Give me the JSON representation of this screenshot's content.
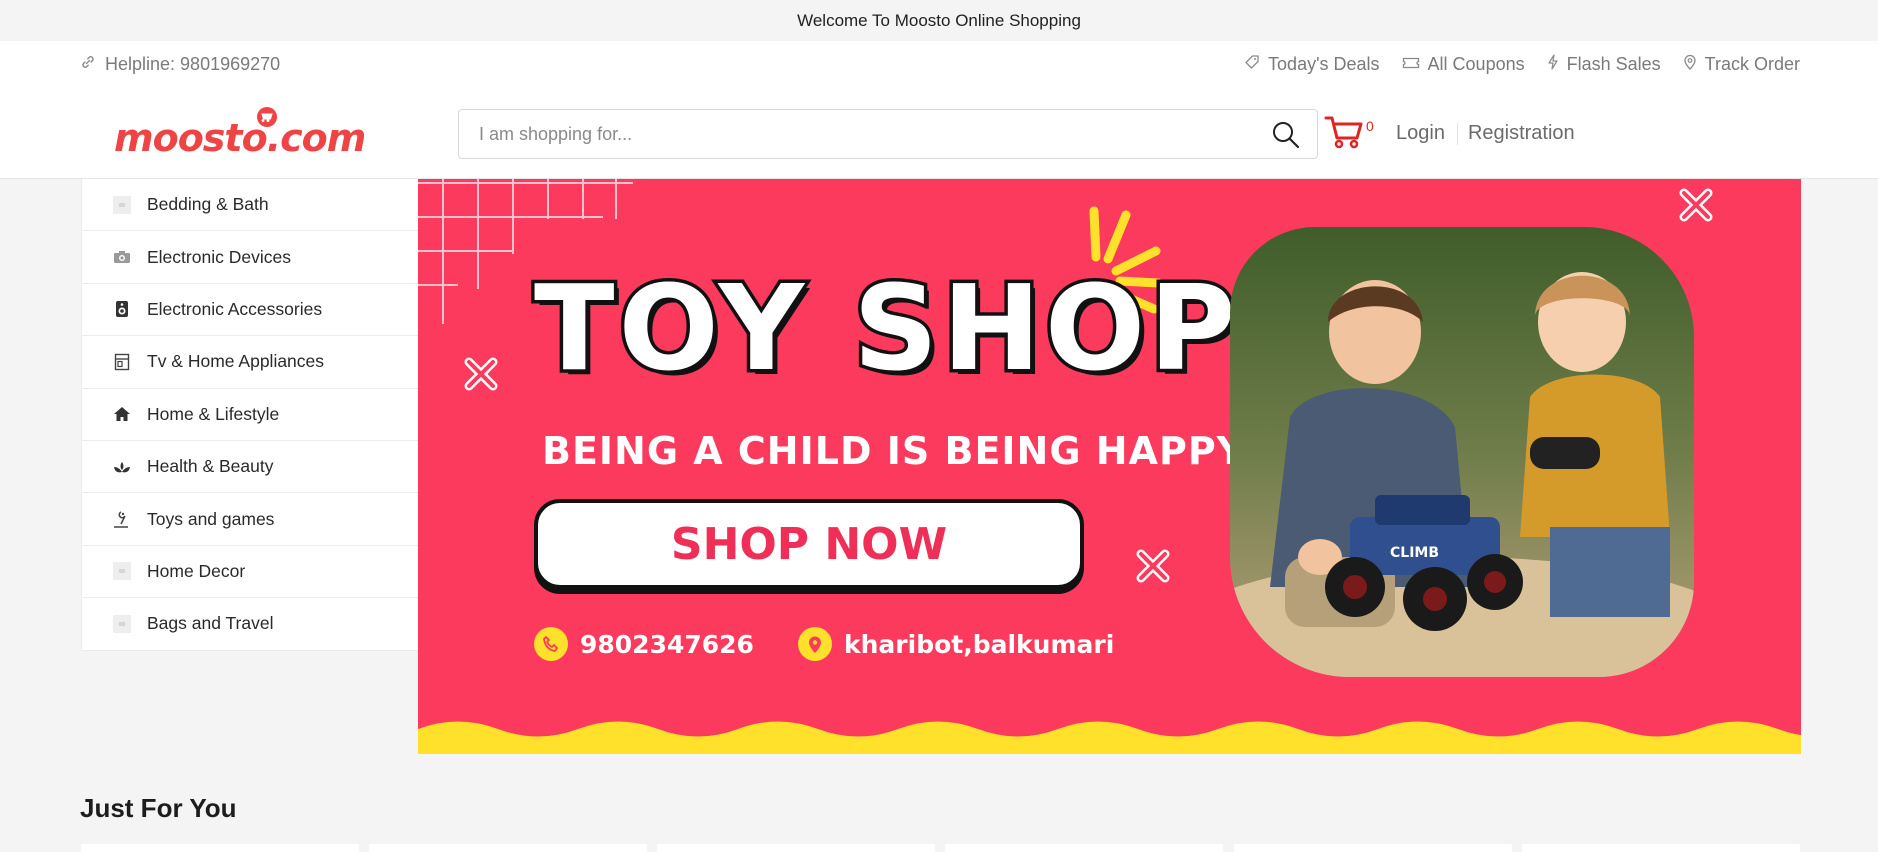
{
  "welcome": {
    "text": "Welcome To Moosto Online Shopping"
  },
  "topbar": {
    "helpline": "Helpline: 9801969270",
    "links": [
      {
        "label": "Today's Deals",
        "icon": "tag-icon"
      },
      {
        "label": "All Coupons",
        "icon": "coupon-icon"
      },
      {
        "label": "Flash Sales",
        "icon": "flash-icon"
      },
      {
        "label": "Track Order",
        "icon": "location-icon"
      }
    ]
  },
  "header": {
    "logo_text": "moosto.com",
    "search": {
      "placeholder": "I am shopping for..."
    },
    "cart_count": "0",
    "login": "Login",
    "registration": "Registration"
  },
  "categories": [
    {
      "label": "Bedding & Bath",
      "icon": "image-placeholder-icon"
    },
    {
      "label": "Electronic Devices",
      "icon": "camera-icon"
    },
    {
      "label": "Electronic Accessories",
      "icon": "speaker-icon"
    },
    {
      "label": "Tv & Home Appliances",
      "icon": "appliance-icon"
    },
    {
      "label": "Home & Lifestyle",
      "icon": "home-icon"
    },
    {
      "label": "Health & Beauty",
      "icon": "lotus-icon"
    },
    {
      "label": "Toys and games",
      "icon": "toy-icon"
    },
    {
      "label": "Home Decor",
      "icon": "image-placeholder-icon"
    },
    {
      "label": "Bags and Travel",
      "icon": "image-placeholder-icon"
    }
  ],
  "banner": {
    "title": "TOY SHOP",
    "tagline": "BEING A CHILD IS BEING HAPPY",
    "cta": "SHOP NOW",
    "phone": "9802347626",
    "address": "kharibot,balkumari",
    "photo_label": "CLIMB"
  },
  "sections": {
    "just_for_you": "Just For You"
  },
  "colors": {
    "brand": "#ef4444",
    "banner_bg": "#fb3a5d",
    "accent_yellow": "#ffe12b",
    "page_bg": "#f4f4f4"
  }
}
